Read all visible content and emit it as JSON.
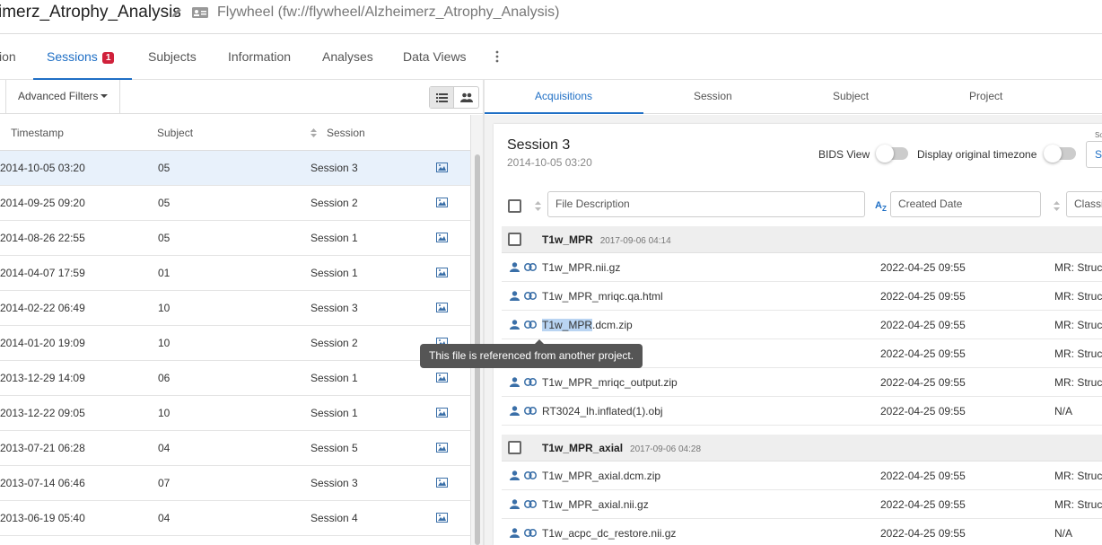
{
  "header": {
    "project_title": "imerz_Atrophy_Analysis",
    "path": "Flywheel (fw://flywheel/Alzheimerz_Atrophy_Analysis)"
  },
  "tabs": [
    {
      "label": "ion",
      "active": false
    },
    {
      "label": "Sessions",
      "active": true,
      "badge": "1"
    },
    {
      "label": "Subjects",
      "active": false
    },
    {
      "label": "Information",
      "active": false
    },
    {
      "label": "Analyses",
      "active": false
    },
    {
      "label": "Data Views",
      "active": false
    }
  ],
  "left": {
    "advanced_filters": "Advanced Filters",
    "columns": {
      "timestamp": "Timestamp",
      "subject": "Subject",
      "session": "Session"
    },
    "rows": [
      {
        "timestamp": "2014-10-05 03:20",
        "subject": "05",
        "session": "Session 3",
        "selected": true
      },
      {
        "timestamp": "2014-09-25 09:20",
        "subject": "05",
        "session": "Session 2"
      },
      {
        "timestamp": "2014-08-26 22:55",
        "subject": "05",
        "session": "Session 1"
      },
      {
        "timestamp": "2014-04-07 17:59",
        "subject": "01",
        "session": "Session 1"
      },
      {
        "timestamp": "2014-02-22 06:49",
        "subject": "10",
        "session": "Session 3"
      },
      {
        "timestamp": "2014-01-20 19:09",
        "subject": "10",
        "session": "Session 2"
      },
      {
        "timestamp": "2013-12-29 14:09",
        "subject": "06",
        "session": "Session 1"
      },
      {
        "timestamp": "2013-12-22 09:05",
        "subject": "10",
        "session": "Session 1"
      },
      {
        "timestamp": "2013-07-21 06:28",
        "subject": "04",
        "session": "Session 5"
      },
      {
        "timestamp": "2013-07-14 06:46",
        "subject": "07",
        "session": "Session 3"
      },
      {
        "timestamp": "2013-06-19 05:40",
        "subject": "04",
        "session": "Session 4"
      }
    ]
  },
  "right": {
    "tabs": [
      {
        "label": "Acquisitions",
        "active": true
      },
      {
        "label": "Session",
        "active": false
      },
      {
        "label": "Subject",
        "active": false
      },
      {
        "label": "Project",
        "active": false
      }
    ],
    "session_title": "Session 3",
    "session_date": "2014-10-05 03:20",
    "bids_view": "BIDS View",
    "display_tz": "Display original timezone",
    "sort_tiny": "So",
    "sort_value": "Se",
    "filters": {
      "file_description": "File Description",
      "created_date": "Created Date",
      "classification": "Classi"
    },
    "groups": [
      {
        "name": "T1w_MPR",
        "date": "2017-09-06 04:14",
        "files": [
          {
            "name": "T1w_MPR.nii.gz",
            "date": "2022-04-25 09:55",
            "class": "MR: Struc"
          },
          {
            "name": "T1w_MPR_mriqc.qa.html",
            "date": "2022-04-25 09:55",
            "class": "MR: Struc"
          },
          {
            "name_hl": "T1w_MPR",
            "name_rest": ".dcm.zip",
            "date": "2022-04-25 09:55",
            "class": "MR: Struc"
          },
          {
            "name": "",
            "date": "2022-04-25 09:55",
            "class": "MR: Struc"
          },
          {
            "name": "T1w_MPR_mriqc_output.zip",
            "date": "2022-04-25 09:55",
            "class": "MR: Struc"
          },
          {
            "name": "RT3024_lh.inflated(1).obj",
            "date": "2022-04-25 09:55",
            "class": "N/A"
          }
        ]
      },
      {
        "name": "T1w_MPR_axial",
        "date": "2017-09-06 04:28",
        "files": [
          {
            "name": "T1w_MPR_axial.dcm.zip",
            "date": "2022-04-25 09:55",
            "class": "MR: Struc"
          },
          {
            "name": "T1w_MPR_axial.nii.gz",
            "date": "2022-04-25 09:55",
            "class": "MR: Struc"
          },
          {
            "name": "T1w_acpc_dc_restore.nii.gz",
            "date": "2022-04-25 09:55",
            "class": "N/A"
          }
        ]
      }
    ]
  },
  "tooltip": "This file is referenced from another project.",
  "colors": {
    "accent": "#1f6fc5",
    "badge": "#d0213b",
    "selected_row": "#e8f1fb",
    "highlight": "#b9d4f2"
  }
}
